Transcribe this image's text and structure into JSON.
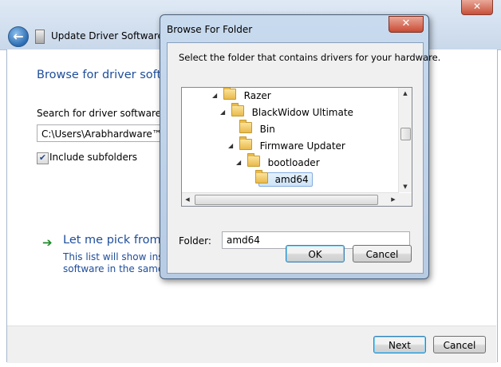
{
  "wizard": {
    "title": "Update Driver Software - U",
    "heading": "Browse for driver softw",
    "search_label": "Search for driver software in t",
    "path_value": "C:\\Users\\Arabhardware™",
    "include_subfolders_label": "Include subfolders",
    "include_subfolders_checked": true,
    "pick_title": "Let me pick from",
    "pick_desc_line1": "This list will show instal",
    "pick_desc_line2": "software in the same ca",
    "next_label": "Next",
    "cancel_label": "Cancel",
    "close_glyph": "✕"
  },
  "dialog": {
    "title": "Browse For Folder",
    "close_glyph": "✕",
    "description": "Select the folder that contains drivers for your hardware.",
    "tree": [
      {
        "label": "Razer",
        "expanded": true,
        "selected": false
      },
      {
        "label": "BlackWidow Ultimate",
        "expanded": true,
        "selected": false
      },
      {
        "label": "Bin",
        "expanded": false,
        "selected": false
      },
      {
        "label": "Firmware Updater",
        "expanded": true,
        "selected": false
      },
      {
        "label": "bootloader",
        "expanded": true,
        "selected": false
      },
      {
        "label": "amd64",
        "expanded": false,
        "selected": true
      }
    ],
    "folder_label": "Folder:",
    "folder_value": "amd64",
    "ok_label": "OK",
    "cancel_label": "Cancel"
  },
  "colors": {
    "link_blue": "#1e4d9b",
    "selection": "#cde4f7",
    "close_red": "#c84b34"
  },
  "icons": {
    "back": "back-arrow-icon",
    "folder": "folder-icon",
    "expand": "expand-triangle-icon"
  }
}
